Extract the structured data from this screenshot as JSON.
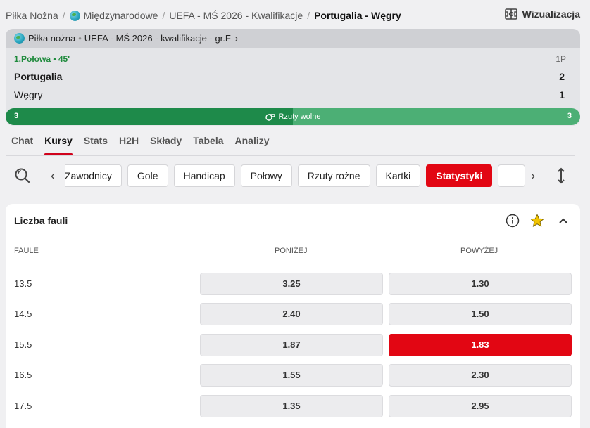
{
  "breadcrumb": {
    "items": [
      "Piłka Nożna",
      "Międzynarodowe",
      "UEFA - MŚ 2026 - Kwalifikacje",
      "Portugalia - Węgry"
    ],
    "separator": "/"
  },
  "header": {
    "visualization_label": "Wizualizacja"
  },
  "match": {
    "league": {
      "sport": "Piłka nożna",
      "separator": "•",
      "competition": "UEFA - MŚ 2026 - kwalifikacje - gr.F",
      "chevron": "›"
    },
    "status": "1.Połowa • 45'",
    "period": "1P",
    "home": {
      "name": "Portugalia",
      "score": "2"
    },
    "away": {
      "name": "Węgry",
      "score": "1"
    },
    "stat_bar": {
      "label": "Rzuty wolne",
      "home_value": "3",
      "away_value": "3",
      "home_share": 0.5
    }
  },
  "tabs": [
    {
      "label": "Chat",
      "active": false
    },
    {
      "label": "Kursy",
      "active": true
    },
    {
      "label": "Stats",
      "active": false
    },
    {
      "label": "H2H",
      "active": false
    },
    {
      "label": "Składy",
      "active": false
    },
    {
      "label": "Tabela",
      "active": false
    },
    {
      "label": "Analizy",
      "active": false
    }
  ],
  "filters": {
    "nav_left": "‹",
    "nav_right": "›",
    "chips": [
      {
        "label": "Zawodnicy",
        "active": false
      },
      {
        "label": "Gole",
        "active": false
      },
      {
        "label": "Handicap",
        "active": false
      },
      {
        "label": "Połowy",
        "active": false
      },
      {
        "label": "Rzuty rożne",
        "active": false
      },
      {
        "label": "Kartki",
        "active": false
      },
      {
        "label": "Statystyki",
        "active": true
      },
      {
        "label": "",
        "active": false
      }
    ]
  },
  "market": {
    "title": "Liczba fauli",
    "columns": {
      "line": "FAULE",
      "under": "PONIŻEJ",
      "over": "POWYŻEJ"
    },
    "rows": [
      {
        "line": "13.5",
        "under": "3.25",
        "over": "1.30",
        "selected": ""
      },
      {
        "line": "14.5",
        "under": "2.40",
        "over": "1.50",
        "selected": ""
      },
      {
        "line": "15.5",
        "under": "1.87",
        "over": "1.83",
        "selected": "over"
      },
      {
        "line": "16.5",
        "under": "1.55",
        "over": "2.30",
        "selected": ""
      },
      {
        "line": "17.5",
        "under": "1.35",
        "over": "2.95",
        "selected": ""
      }
    ]
  },
  "colors": {
    "accent_red": "#e20613",
    "live_green": "#1e8a3c",
    "bar_home": "#1e8a4a",
    "bar_away": "#4caf75"
  },
  "icons": [
    "globe-icon",
    "visualization-icon",
    "search-icon",
    "chevron-left-icon",
    "chevron-right-icon",
    "expand-icon",
    "info-icon",
    "star-icon",
    "chevron-up-icon",
    "whistle-icon"
  ]
}
